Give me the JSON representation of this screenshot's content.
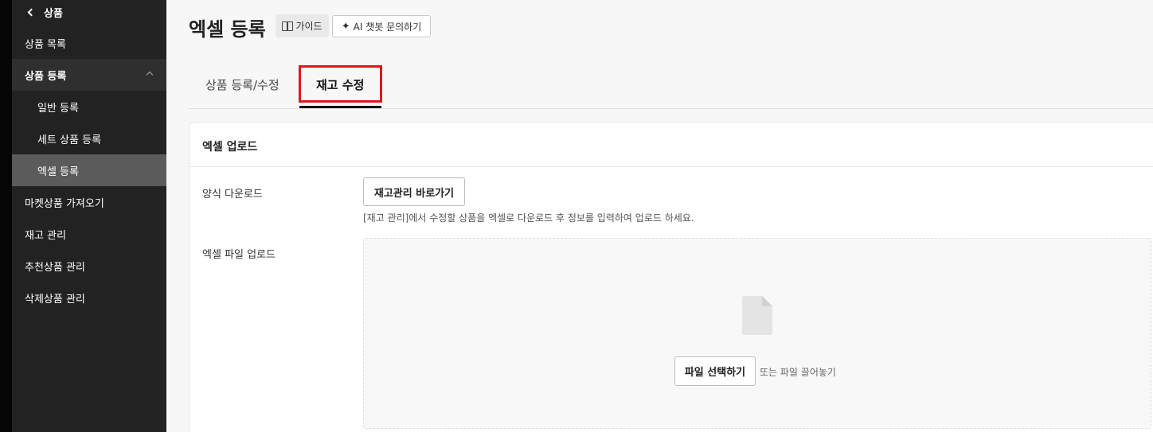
{
  "sidebar": {
    "back_label": "상품",
    "items": [
      {
        "label": "상품 목록"
      },
      {
        "label": "상품 등록"
      },
      {
        "label": "일반 등록"
      },
      {
        "label": "세트 상품 등록"
      },
      {
        "label": "엑셀 등록"
      },
      {
        "label": "마켓상품 가져오기"
      },
      {
        "label": "재고 관리"
      },
      {
        "label": "추천상품 관리"
      },
      {
        "label": "삭제상품 관리"
      }
    ]
  },
  "header": {
    "title": "엑셀 등록",
    "guide_label": "가이드",
    "ai_label": "AI 챗봇 문의하기"
  },
  "tabs": [
    {
      "label": "상품 등록/수정"
    },
    {
      "label": "재고 수정"
    }
  ],
  "card": {
    "title": "엑셀 업로드",
    "download_label": "양식 다운로드",
    "stock_button": "재고관리 바로가기",
    "helper_text": "[재고 관리]에서 수정할 상품을 엑셀로 다운로드 후 정보를 입력하여 업로드 하세요.",
    "upload_label": "엑셀 파일 업로드",
    "file_button": "파일 선택하기",
    "drop_hint": "또는 파일 끌어놓기"
  },
  "colors": {
    "sidebar_bg": "#222222",
    "sidebar_selected": "#5b5b5b",
    "highlight": "#e1141e"
  }
}
